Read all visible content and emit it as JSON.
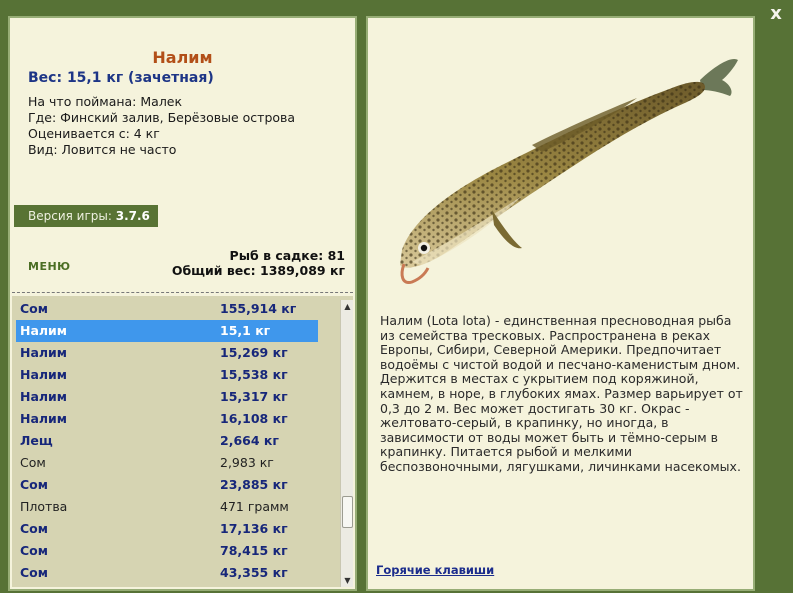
{
  "close_label": "x",
  "info": {
    "name": "Налим",
    "weight": "Вес: 15,1 кг (зачетная)",
    "caught_with": "На что поймана: Малек",
    "where": "Где: Финский залив, Берёзовые острова",
    "rated_from": "Оценивается с: 4 кг",
    "kind": "Вид: Ловится не часто"
  },
  "version": {
    "label": "Версия игры: ",
    "value": "3.7.6"
  },
  "menu_label": "МЕНЮ",
  "totals": {
    "fish_in_keepnet": "Рыб в садке: 81",
    "total_weight": "Общий вес: 1389,089 кг"
  },
  "fish_list": [
    {
      "name": "Сом",
      "weight": "155,914 кг",
      "style": "bold"
    },
    {
      "name": "Налим",
      "weight": "15,1 кг",
      "style": "sel"
    },
    {
      "name": "Налим",
      "weight": "15,269 кг",
      "style": "bold"
    },
    {
      "name": "Налим",
      "weight": "15,538 кг",
      "style": "bold"
    },
    {
      "name": "Налим",
      "weight": "15,317 кг",
      "style": "bold"
    },
    {
      "name": "Налим",
      "weight": "16,108 кг",
      "style": "bold"
    },
    {
      "name": "Лещ",
      "weight": "2,664 кг",
      "style": "bold"
    },
    {
      "name": "Сом",
      "weight": "2,983 кг",
      "style": "plain"
    },
    {
      "name": "Сом",
      "weight": "23,885 кг",
      "style": "bold"
    },
    {
      "name": "Плотва",
      "weight": "471 грамм",
      "style": "plain"
    },
    {
      "name": "Сом",
      "weight": "17,136 кг",
      "style": "bold"
    },
    {
      "name": "Сом",
      "weight": "78,415 кг",
      "style": "bold"
    },
    {
      "name": "Сом",
      "weight": "43,355 кг",
      "style": "bold"
    }
  ],
  "description": "Налим (Lota lota) - единственная пресноводная рыба из семейства тресковых. Распространена в реках Европы, Сибири, Северной Америки. Предпочитает водоёмы с чистой водой и песчано-каменистым дном. Держится в местах с укрытием под коряжиной, камнем, в норе, в глубоких ямах. Размер варьирует от 0,3 до 2 м. Вес может достигать 30 кг. Окрас - желтовато-серый, в крапинку, но иногда, в зависимости от воды может быть и тёмно-серым в крапинку. Питается рыбой и мелкими беспозвоночными, лягушками, личинками насекомых.",
  "hotkeys_label": "Горячие клавиши",
  "icons": {
    "close": "close-icon",
    "fish": "burbot-fish-image"
  },
  "colors": {
    "background": "#577236",
    "panel": "#f5f3dc",
    "selection": "#3f97ec",
    "title": "#b24f18"
  }
}
